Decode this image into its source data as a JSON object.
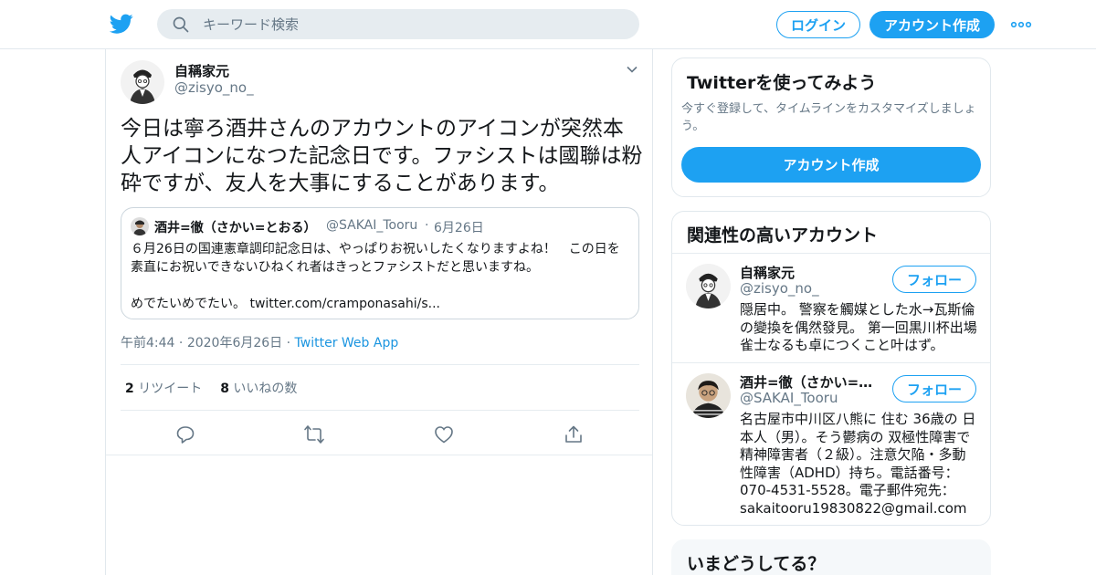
{
  "colors": {
    "accent": "#1da1f2",
    "border": "#e1e8ed",
    "muted": "#657786",
    "text": "#14171a"
  },
  "header": {
    "logo_icon": "twitter-bird-icon",
    "search_placeholder": "キーワード検索",
    "login_label": "ログイン",
    "signup_label": "アカウント作成",
    "more_icon": "more-dots-icon"
  },
  "tweet": {
    "author_name": "自稱家元",
    "author_handle": "@zisyo_no_",
    "text": "今日は寧ろ酒井さんのアカウントのアイコンが突然本人アイコンになつた記念日です。ファシストは國聯は粉砕ですが、友人を大事にすることがあります。",
    "quote": {
      "name": "酒井=徹（さかい=とおる）",
      "handle": "@SAKAI_Tooru",
      "dot": "·",
      "date": "6月26日",
      "text": "６月26日の国連憲章調印記念日は、やっぱりお祝いしたくなりますよね！　この日を素直にお祝いできないひねくれ者はきっとファシストだと思いますね。\n\nめでたいめでたい。 twitter.com/cramponasahi/s..."
    },
    "time": "午前4:44",
    "sep1": "·",
    "date": "2020年6月26日",
    "sep2": "·",
    "source": "Twitter Web App",
    "retweet_count": "2",
    "retweet_label": "リツイート",
    "like_count": "8",
    "like_label": "いいねの数"
  },
  "sidebar": {
    "join": {
      "title": "Twitterを使ってみよう",
      "subtitle": "今すぐ登録して、タイムラインをカスタマイズしましょう。",
      "button": "アカウント作成"
    },
    "related": {
      "title": "関連性の高いアカウント",
      "accounts": [
        {
          "name": "自稱家元",
          "handle": "@zisyo_no_",
          "bio": "隠居中。 警察を觸媒とした水→瓦斯倫の變換を偶然發見。 第一回黒川杯出場雀士なるも卓につくこと叶はず。",
          "follow": "フォロー"
        },
        {
          "name": "酒井=徹（さかい=とおる）",
          "handle": "@SAKAI_Tooru",
          "bio": "名古屋市中川区八熊に 住む 36歳の 日本人（男）。そう鬱病の 双極性障害で 精神障害者（２級）。注意欠陥・多動性障害（ADHD）持ち。電話番号：070-4531-5528。電子郵件宛先：sakaitooru19830822@gmail.com",
          "follow": "フォロー"
        }
      ]
    },
    "trends": {
      "title": "いまどうしてる？"
    }
  }
}
